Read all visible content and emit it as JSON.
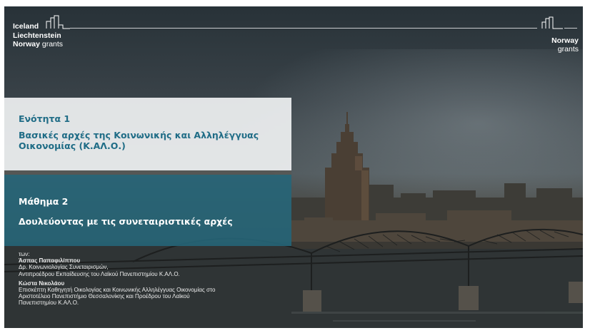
{
  "logos": {
    "left": {
      "line1": "Iceland",
      "line2": "Liechtenstein",
      "line3_bold": "Norway",
      "line3_normal": "grants"
    },
    "right": {
      "line1": "Norway",
      "line2": "grants"
    }
  },
  "unit": {
    "label": "Ενότητα 1",
    "title": "Βασικές αρχές της Κοινωνικής και Αλληλέγγυας Οικονομίας (Κ.ΑΛ.Ο.)"
  },
  "lesson": {
    "label": "Μάθημα 2",
    "title": "Δουλεύοντας με τις συνεταιριστικές αρχές"
  },
  "credits": {
    "intro": "των:",
    "author1": {
      "name": "Άσπας Παπαφιλίππου",
      "line1": "Δρ. Κοινωνιολογίας Συνεταιρισμών,",
      "line2": "Αντιπροέδρου Εκπαίδευσης του Λαϊκού Πανεπιστημίου Κ.ΑΛ.Ο."
    },
    "author2": {
      "name": "Κώστα Νικολάου",
      "line1": "Επισκέπτη Καθηγητή Οικολογίας και Κοινωνικής Αλληλέγγυας Οικονομίας στο",
      "line2": "Αριστοτέλειο Πανεπιστήμιο Θεσσαλονίκης και Προέδρου του Λαϊκού",
      "line3": "Πανεπιστημίου Κ.ΑΛ.Ο."
    }
  }
}
